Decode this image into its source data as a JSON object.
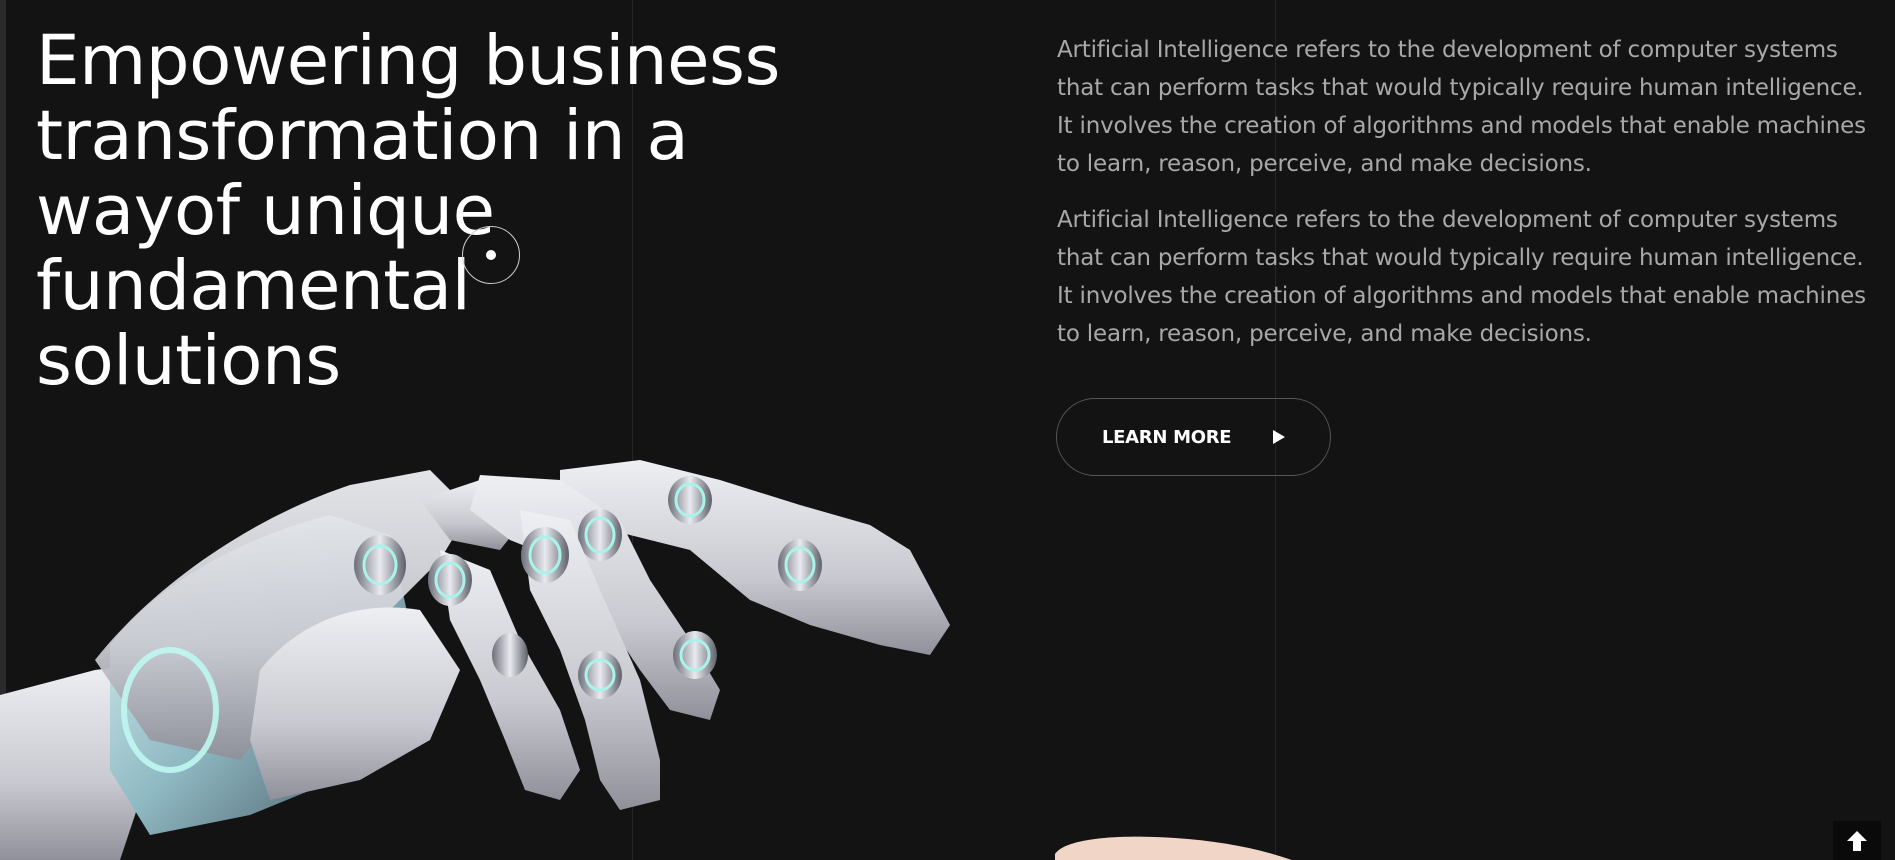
{
  "hero": {
    "headline_lines": [
      "Empowering business",
      "transformation in a",
      "wayof unique",
      "fundamental",
      "solutions"
    ],
    "paragraphs": [
      "Artificial Intelligence refers to the development of computer systems that can perform tasks that would typically require human intelligence. It involves the creation of algorithms and models that enable machines to learn, reason, perceive, and make decisions.",
      "Artificial Intelligence refers to the development of computer systems that can perform tasks that would typically require human intelligence. It involves the creation of algorithms and models that enable machines to learn, reason, perceive, and make decisions."
    ],
    "cta_label": "LEARN MORE",
    "cta_icon": "play-arrow-icon"
  },
  "images": {
    "robot_hand": "robot-hand-image",
    "human_finger": "human-finger-image"
  },
  "scroll_top": {
    "icon": "arrow-up-icon"
  },
  "colors": {
    "background": "#131313",
    "headline": "#ffffff",
    "body_text": "#a8a8a8",
    "button_border": "#555555"
  }
}
